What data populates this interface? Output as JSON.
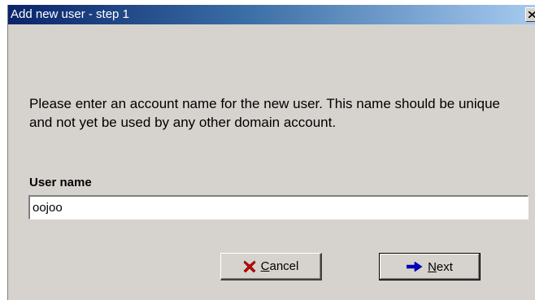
{
  "window": {
    "title": "Add new user - step 1",
    "close_icon": "close-icon"
  },
  "content": {
    "instructions": "Please enter an account name for the new user. This name should be unique and not yet be used by any other domain account."
  },
  "form": {
    "user_name_label": "User name",
    "user_name_value": "oojoo"
  },
  "buttons": {
    "cancel": {
      "accel": "C",
      "rest": "ancel",
      "icon": "red-x-icon",
      "icon_color": "#cc0000"
    },
    "next": {
      "accel": "N",
      "rest": "ext",
      "icon": "blue-arrow-right-icon",
      "icon_color": "#0000cc"
    }
  },
  "colors": {
    "dialog_background": "#d6d3ce",
    "titlebar_start": "#0a246a",
    "titlebar_end": "#a6caf0"
  }
}
